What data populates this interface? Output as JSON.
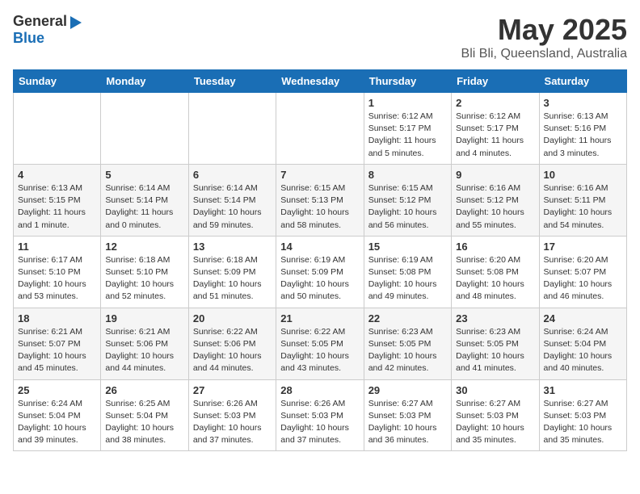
{
  "header": {
    "logo_general": "General",
    "logo_blue": "Blue",
    "title": "May 2025",
    "subtitle": "Bli Bli, Queensland, Australia"
  },
  "days_of_week": [
    "Sunday",
    "Monday",
    "Tuesday",
    "Wednesday",
    "Thursday",
    "Friday",
    "Saturday"
  ],
  "weeks": [
    [
      {
        "day": "",
        "info": ""
      },
      {
        "day": "",
        "info": ""
      },
      {
        "day": "",
        "info": ""
      },
      {
        "day": "",
        "info": ""
      },
      {
        "day": "1",
        "info": "Sunrise: 6:12 AM\nSunset: 5:17 PM\nDaylight: 11 hours\nand 5 minutes."
      },
      {
        "day": "2",
        "info": "Sunrise: 6:12 AM\nSunset: 5:17 PM\nDaylight: 11 hours\nand 4 minutes."
      },
      {
        "day": "3",
        "info": "Sunrise: 6:13 AM\nSunset: 5:16 PM\nDaylight: 11 hours\nand 3 minutes."
      }
    ],
    [
      {
        "day": "4",
        "info": "Sunrise: 6:13 AM\nSunset: 5:15 PM\nDaylight: 11 hours\nand 1 minute."
      },
      {
        "day": "5",
        "info": "Sunrise: 6:14 AM\nSunset: 5:14 PM\nDaylight: 11 hours\nand 0 minutes."
      },
      {
        "day": "6",
        "info": "Sunrise: 6:14 AM\nSunset: 5:14 PM\nDaylight: 10 hours\nand 59 minutes."
      },
      {
        "day": "7",
        "info": "Sunrise: 6:15 AM\nSunset: 5:13 PM\nDaylight: 10 hours\nand 58 minutes."
      },
      {
        "day": "8",
        "info": "Sunrise: 6:15 AM\nSunset: 5:12 PM\nDaylight: 10 hours\nand 56 minutes."
      },
      {
        "day": "9",
        "info": "Sunrise: 6:16 AM\nSunset: 5:12 PM\nDaylight: 10 hours\nand 55 minutes."
      },
      {
        "day": "10",
        "info": "Sunrise: 6:16 AM\nSunset: 5:11 PM\nDaylight: 10 hours\nand 54 minutes."
      }
    ],
    [
      {
        "day": "11",
        "info": "Sunrise: 6:17 AM\nSunset: 5:10 PM\nDaylight: 10 hours\nand 53 minutes."
      },
      {
        "day": "12",
        "info": "Sunrise: 6:18 AM\nSunset: 5:10 PM\nDaylight: 10 hours\nand 52 minutes."
      },
      {
        "day": "13",
        "info": "Sunrise: 6:18 AM\nSunset: 5:09 PM\nDaylight: 10 hours\nand 51 minutes."
      },
      {
        "day": "14",
        "info": "Sunrise: 6:19 AM\nSunset: 5:09 PM\nDaylight: 10 hours\nand 50 minutes."
      },
      {
        "day": "15",
        "info": "Sunrise: 6:19 AM\nSunset: 5:08 PM\nDaylight: 10 hours\nand 49 minutes."
      },
      {
        "day": "16",
        "info": "Sunrise: 6:20 AM\nSunset: 5:08 PM\nDaylight: 10 hours\nand 48 minutes."
      },
      {
        "day": "17",
        "info": "Sunrise: 6:20 AM\nSunset: 5:07 PM\nDaylight: 10 hours\nand 46 minutes."
      }
    ],
    [
      {
        "day": "18",
        "info": "Sunrise: 6:21 AM\nSunset: 5:07 PM\nDaylight: 10 hours\nand 45 minutes."
      },
      {
        "day": "19",
        "info": "Sunrise: 6:21 AM\nSunset: 5:06 PM\nDaylight: 10 hours\nand 44 minutes."
      },
      {
        "day": "20",
        "info": "Sunrise: 6:22 AM\nSunset: 5:06 PM\nDaylight: 10 hours\nand 44 minutes."
      },
      {
        "day": "21",
        "info": "Sunrise: 6:22 AM\nSunset: 5:05 PM\nDaylight: 10 hours\nand 43 minutes."
      },
      {
        "day": "22",
        "info": "Sunrise: 6:23 AM\nSunset: 5:05 PM\nDaylight: 10 hours\nand 42 minutes."
      },
      {
        "day": "23",
        "info": "Sunrise: 6:23 AM\nSunset: 5:05 PM\nDaylight: 10 hours\nand 41 minutes."
      },
      {
        "day": "24",
        "info": "Sunrise: 6:24 AM\nSunset: 5:04 PM\nDaylight: 10 hours\nand 40 minutes."
      }
    ],
    [
      {
        "day": "25",
        "info": "Sunrise: 6:24 AM\nSunset: 5:04 PM\nDaylight: 10 hours\nand 39 minutes."
      },
      {
        "day": "26",
        "info": "Sunrise: 6:25 AM\nSunset: 5:04 PM\nDaylight: 10 hours\nand 38 minutes."
      },
      {
        "day": "27",
        "info": "Sunrise: 6:26 AM\nSunset: 5:03 PM\nDaylight: 10 hours\nand 37 minutes."
      },
      {
        "day": "28",
        "info": "Sunrise: 6:26 AM\nSunset: 5:03 PM\nDaylight: 10 hours\nand 37 minutes."
      },
      {
        "day": "29",
        "info": "Sunrise: 6:27 AM\nSunset: 5:03 PM\nDaylight: 10 hours\nand 36 minutes."
      },
      {
        "day": "30",
        "info": "Sunrise: 6:27 AM\nSunset: 5:03 PM\nDaylight: 10 hours\nand 35 minutes."
      },
      {
        "day": "31",
        "info": "Sunrise: 6:27 AM\nSunset: 5:03 PM\nDaylight: 10 hours\nand 35 minutes."
      }
    ]
  ]
}
